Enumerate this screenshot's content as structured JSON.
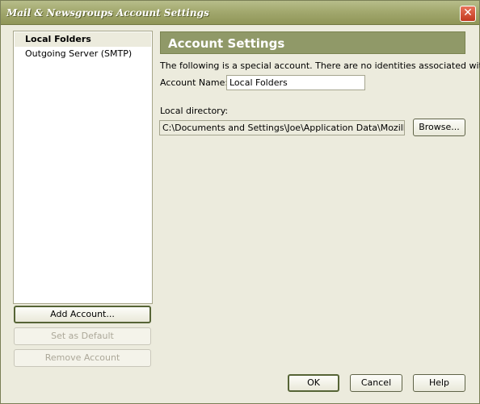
{
  "window": {
    "title": "Mail & Newsgroups Account Settings",
    "close_symbol": "✕"
  },
  "account_tree": {
    "items": [
      {
        "label": "Local Folders",
        "selected": true
      },
      {
        "label": "Outgoing Server (SMTP)",
        "selected": false
      }
    ]
  },
  "left_buttons": {
    "add_account": "Add Account...",
    "set_default": "Set as Default",
    "remove_account": "Remove Account"
  },
  "panel": {
    "header": "Account Settings",
    "special_note": "The following is a special account. There are no identities associated with it.",
    "account_name_label": "Account Name:",
    "account_name_value": "Local Folders",
    "local_directory_label": "Local directory:",
    "local_directory_value": "C:\\Documents and Settings\\Joe\\Application Data\\Mozilla\\Profiles",
    "browse_label": "Browse..."
  },
  "footer": {
    "ok": "OK",
    "cancel": "Cancel",
    "help": "Help"
  },
  "colors": {
    "titlebar": "#a3a96f",
    "panel_header": "#909968",
    "dialog_bg": "#ecebdd"
  }
}
